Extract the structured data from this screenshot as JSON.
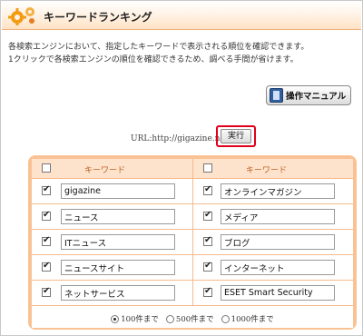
{
  "header": {
    "title": "キーワードランキング",
    "icon": "gears-icon"
  },
  "description": [
    "各検索エンジンにおいて、指定したキーワードで表示される順位を確認できます。",
    "1クリックで各検索エンジンの順位を確認できるため、調べる手間が省けます。"
  ],
  "manual_button": {
    "label": "操作マニュアル",
    "icon": "film-book-icon"
  },
  "url_label": "URL:http://gigazine.net/",
  "run_button": {
    "label": "実行",
    "highlight_color": "#e0001b"
  },
  "table": {
    "header_label_left": "キーワード",
    "header_label_right": "キーワード",
    "left_keywords": [
      "gigazine",
      "ニュース",
      "ITニュース",
      "ニュースサイト",
      "ネットサービス"
    ],
    "right_keywords": [
      "オンラインマガジン",
      "メディア",
      "ブログ",
      "インターネット",
      "ESET Smart Security"
    ]
  },
  "limit_options": [
    "100件まで",
    "500件まで",
    "1000件まで"
  ],
  "limit_selected": "100件まで",
  "colors": {
    "accent": "#f9c295",
    "header_fill": "#fde3cc",
    "header_text": "#c06326"
  }
}
